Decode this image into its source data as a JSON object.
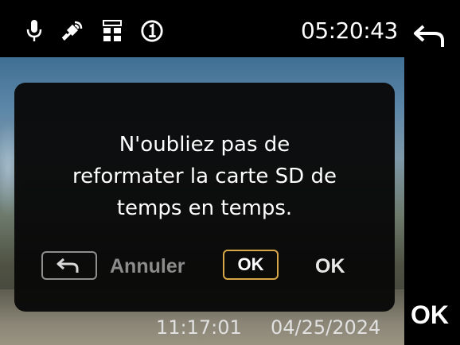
{
  "status_bar": {
    "icons": [
      "microphone-icon",
      "gps-satellite-icon",
      "wifi-signal-icon",
      "recording-mode-icon"
    ],
    "time": "05:20:43",
    "back_icon": "return-arrow-icon"
  },
  "dialog": {
    "message_lines": [
      "N'oubliez pas de",
      "reformater la carte SD de",
      "temps en temps."
    ],
    "back_key_icon": "return-arrow-icon",
    "cancel_label": "Annuler",
    "ok_key_label": "OK",
    "ok_label": "OK"
  },
  "side": {
    "ok_label": "OK"
  },
  "overlay": {
    "time": "11:17:01",
    "date": "04/25/2024"
  },
  "colors": {
    "background": "#000000",
    "dialog_background": "#080808",
    "ok_key_border": "#d8a848",
    "cancel_text": "#8c8c8c"
  }
}
